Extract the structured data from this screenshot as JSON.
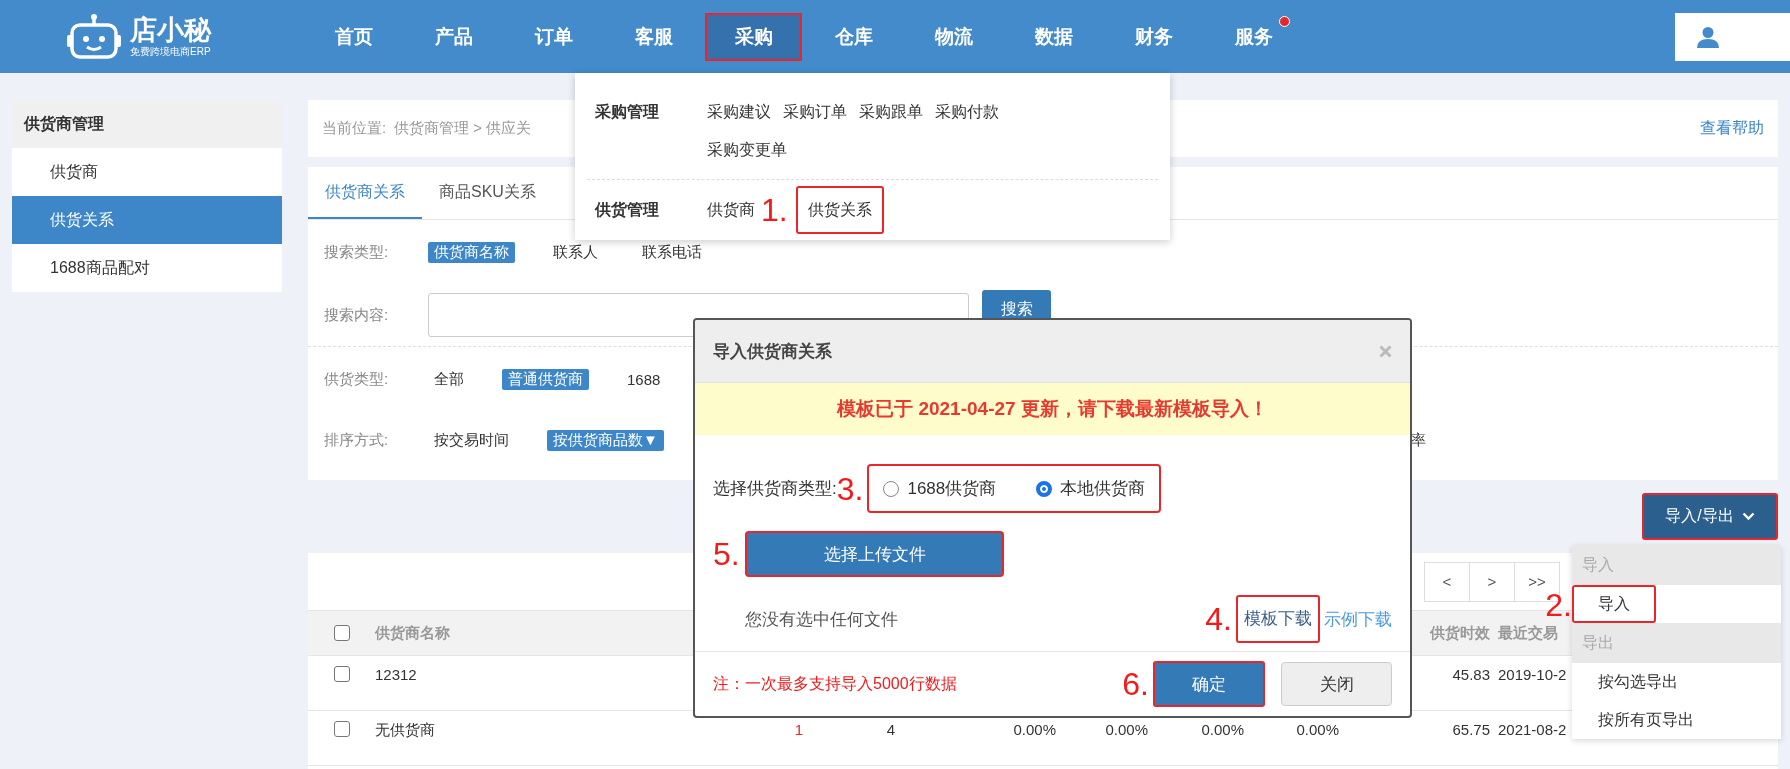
{
  "header": {
    "logo": {
      "name": "店小秘",
      "tagline": "免费跨境电商ERP"
    },
    "nav": [
      {
        "label": "首页",
        "selected": false,
        "highlighted": false,
        "badge": false
      },
      {
        "label": "产品",
        "selected": false,
        "highlighted": false,
        "badge": false
      },
      {
        "label": "订单",
        "selected": false,
        "highlighted": false,
        "badge": false
      },
      {
        "label": "客服",
        "selected": false,
        "highlighted": false,
        "badge": false
      },
      {
        "label": "采购",
        "selected": true,
        "highlighted": true,
        "badge": false
      },
      {
        "label": "仓库",
        "selected": false,
        "highlighted": false,
        "badge": false
      },
      {
        "label": "物流",
        "selected": false,
        "highlighted": false,
        "badge": false
      },
      {
        "label": "数据",
        "selected": false,
        "highlighted": false,
        "badge": false
      },
      {
        "label": "财务",
        "selected": false,
        "highlighted": false,
        "badge": false
      },
      {
        "label": "服务",
        "selected": false,
        "highlighted": false,
        "badge": true
      }
    ]
  },
  "sidebar": {
    "title": "供货商管理",
    "items": [
      {
        "label": "供货商",
        "selected": false
      },
      {
        "label": "供货关系",
        "selected": true
      },
      {
        "label": "1688商品配对",
        "selected": false
      }
    ]
  },
  "breadcrumb": {
    "label": "当前位置:",
    "path": "供货商管理 > 供应关"
  },
  "help_link": "查看帮助",
  "tabs": [
    {
      "label": "供货商关系",
      "selected": true
    },
    {
      "label": "商品SKU关系",
      "selected": false
    }
  ],
  "filters": [
    {
      "kind": "options",
      "label": "搜索类型:",
      "options": [
        {
          "label": "供货商名称",
          "selected": true
        },
        {
          "label": "联系人",
          "selected": false
        },
        {
          "label": "联系电话",
          "selected": false
        }
      ]
    },
    {
      "kind": "search",
      "label": "搜索内容:",
      "button": "搜索"
    },
    {
      "kind": "options",
      "label": "供货类型:",
      "options": [
        {
          "label": "全部",
          "selected": false
        },
        {
          "label": "普通供货商",
          "selected": true
        },
        {
          "label": "1688",
          "selected": false
        }
      ]
    },
    {
      "kind": "options",
      "label": "排序方式:",
      "options": [
        {
          "label": "按交易时间",
          "selected": false
        },
        {
          "label": "按供货商品数▼",
          "selected": true
        }
      ],
      "tail": "率"
    }
  ],
  "import_export_button": {
    "label": "导入/导出",
    "highlighted": true
  },
  "table": {
    "pager": [
      "<",
      ">",
      ">>"
    ],
    "header_checked": false,
    "columns": [
      "供货商名称",
      null,
      null,
      null,
      null,
      null,
      null,
      "供货时效",
      "最近交易"
    ],
    "rows": [
      {
        "checked": false,
        "cells": [
          {
            "text": "12312",
            "alert": false
          },
          null,
          null,
          null,
          null,
          null,
          null,
          {
            "text": "45.83",
            "alert": false
          },
          {
            "text": "2019-10-2",
            "alert": false
          }
        ]
      },
      {
        "checked": false,
        "cells": [
          {
            "text": "无供货商",
            "alert": false
          },
          {
            "text": "1",
            "alert": true
          },
          {
            "text": "4",
            "alert": false
          },
          {
            "text": "0.00%",
            "alert": false
          },
          {
            "text": "0.00%",
            "alert": false
          },
          {
            "text": "0.00%",
            "alert": false
          },
          {
            "text": "0.00%",
            "alert": false
          },
          {
            "text": "65.75",
            "alert": false
          },
          {
            "text": "2021-08-2",
            "alert": false
          }
        ]
      }
    ]
  },
  "purchase_menu": {
    "groups": [
      {
        "title": "采购管理",
        "links": [
          {
            "label": "采购建议",
            "highlighted": false
          },
          {
            "label": "采购订单",
            "highlighted": false
          },
          {
            "label": "采购跟单",
            "highlighted": false
          },
          {
            "label": "采购付款",
            "highlighted": false
          },
          {
            "label": "采购变更单",
            "highlighted": false
          }
        ]
      },
      {
        "title": "供货管理",
        "links": [
          {
            "label": "供货商",
            "highlighted": false
          },
          {
            "label": "供货关系",
            "highlighted": true,
            "step": "1."
          }
        ]
      }
    ]
  },
  "import_dialog": {
    "title": "导入供货商关系",
    "notice": "模板已于 2021-04-27 更新，请下载最新模板导入！",
    "type_label": "选择供货商类型:",
    "type_select": {
      "step": "3.",
      "options": [
        {
          "label": "1688供货商",
          "selected": false
        },
        {
          "label": "本地供货商",
          "selected": true
        }
      ]
    },
    "upload_button": {
      "label": "选择上传文件",
      "step": "5."
    },
    "file_status": "您没有选中任何文件",
    "template_link": {
      "label": "模板下载",
      "step": "4."
    },
    "example_link": "示例下载",
    "note": "注：一次最多支持导入5000行数据",
    "confirm_button": {
      "label": "确定",
      "step": "6."
    },
    "close_button": "关闭"
  },
  "import_export_menu": {
    "groups": [
      {
        "title": "导入",
        "items": [
          {
            "label": "导入",
            "highlighted": true,
            "step": "2."
          }
        ]
      },
      {
        "title": "导出",
        "items": [
          {
            "label": "按勾选导出",
            "highlighted": false
          },
          {
            "label": "按所有页导出",
            "highlighted": false
          }
        ]
      }
    ]
  }
}
